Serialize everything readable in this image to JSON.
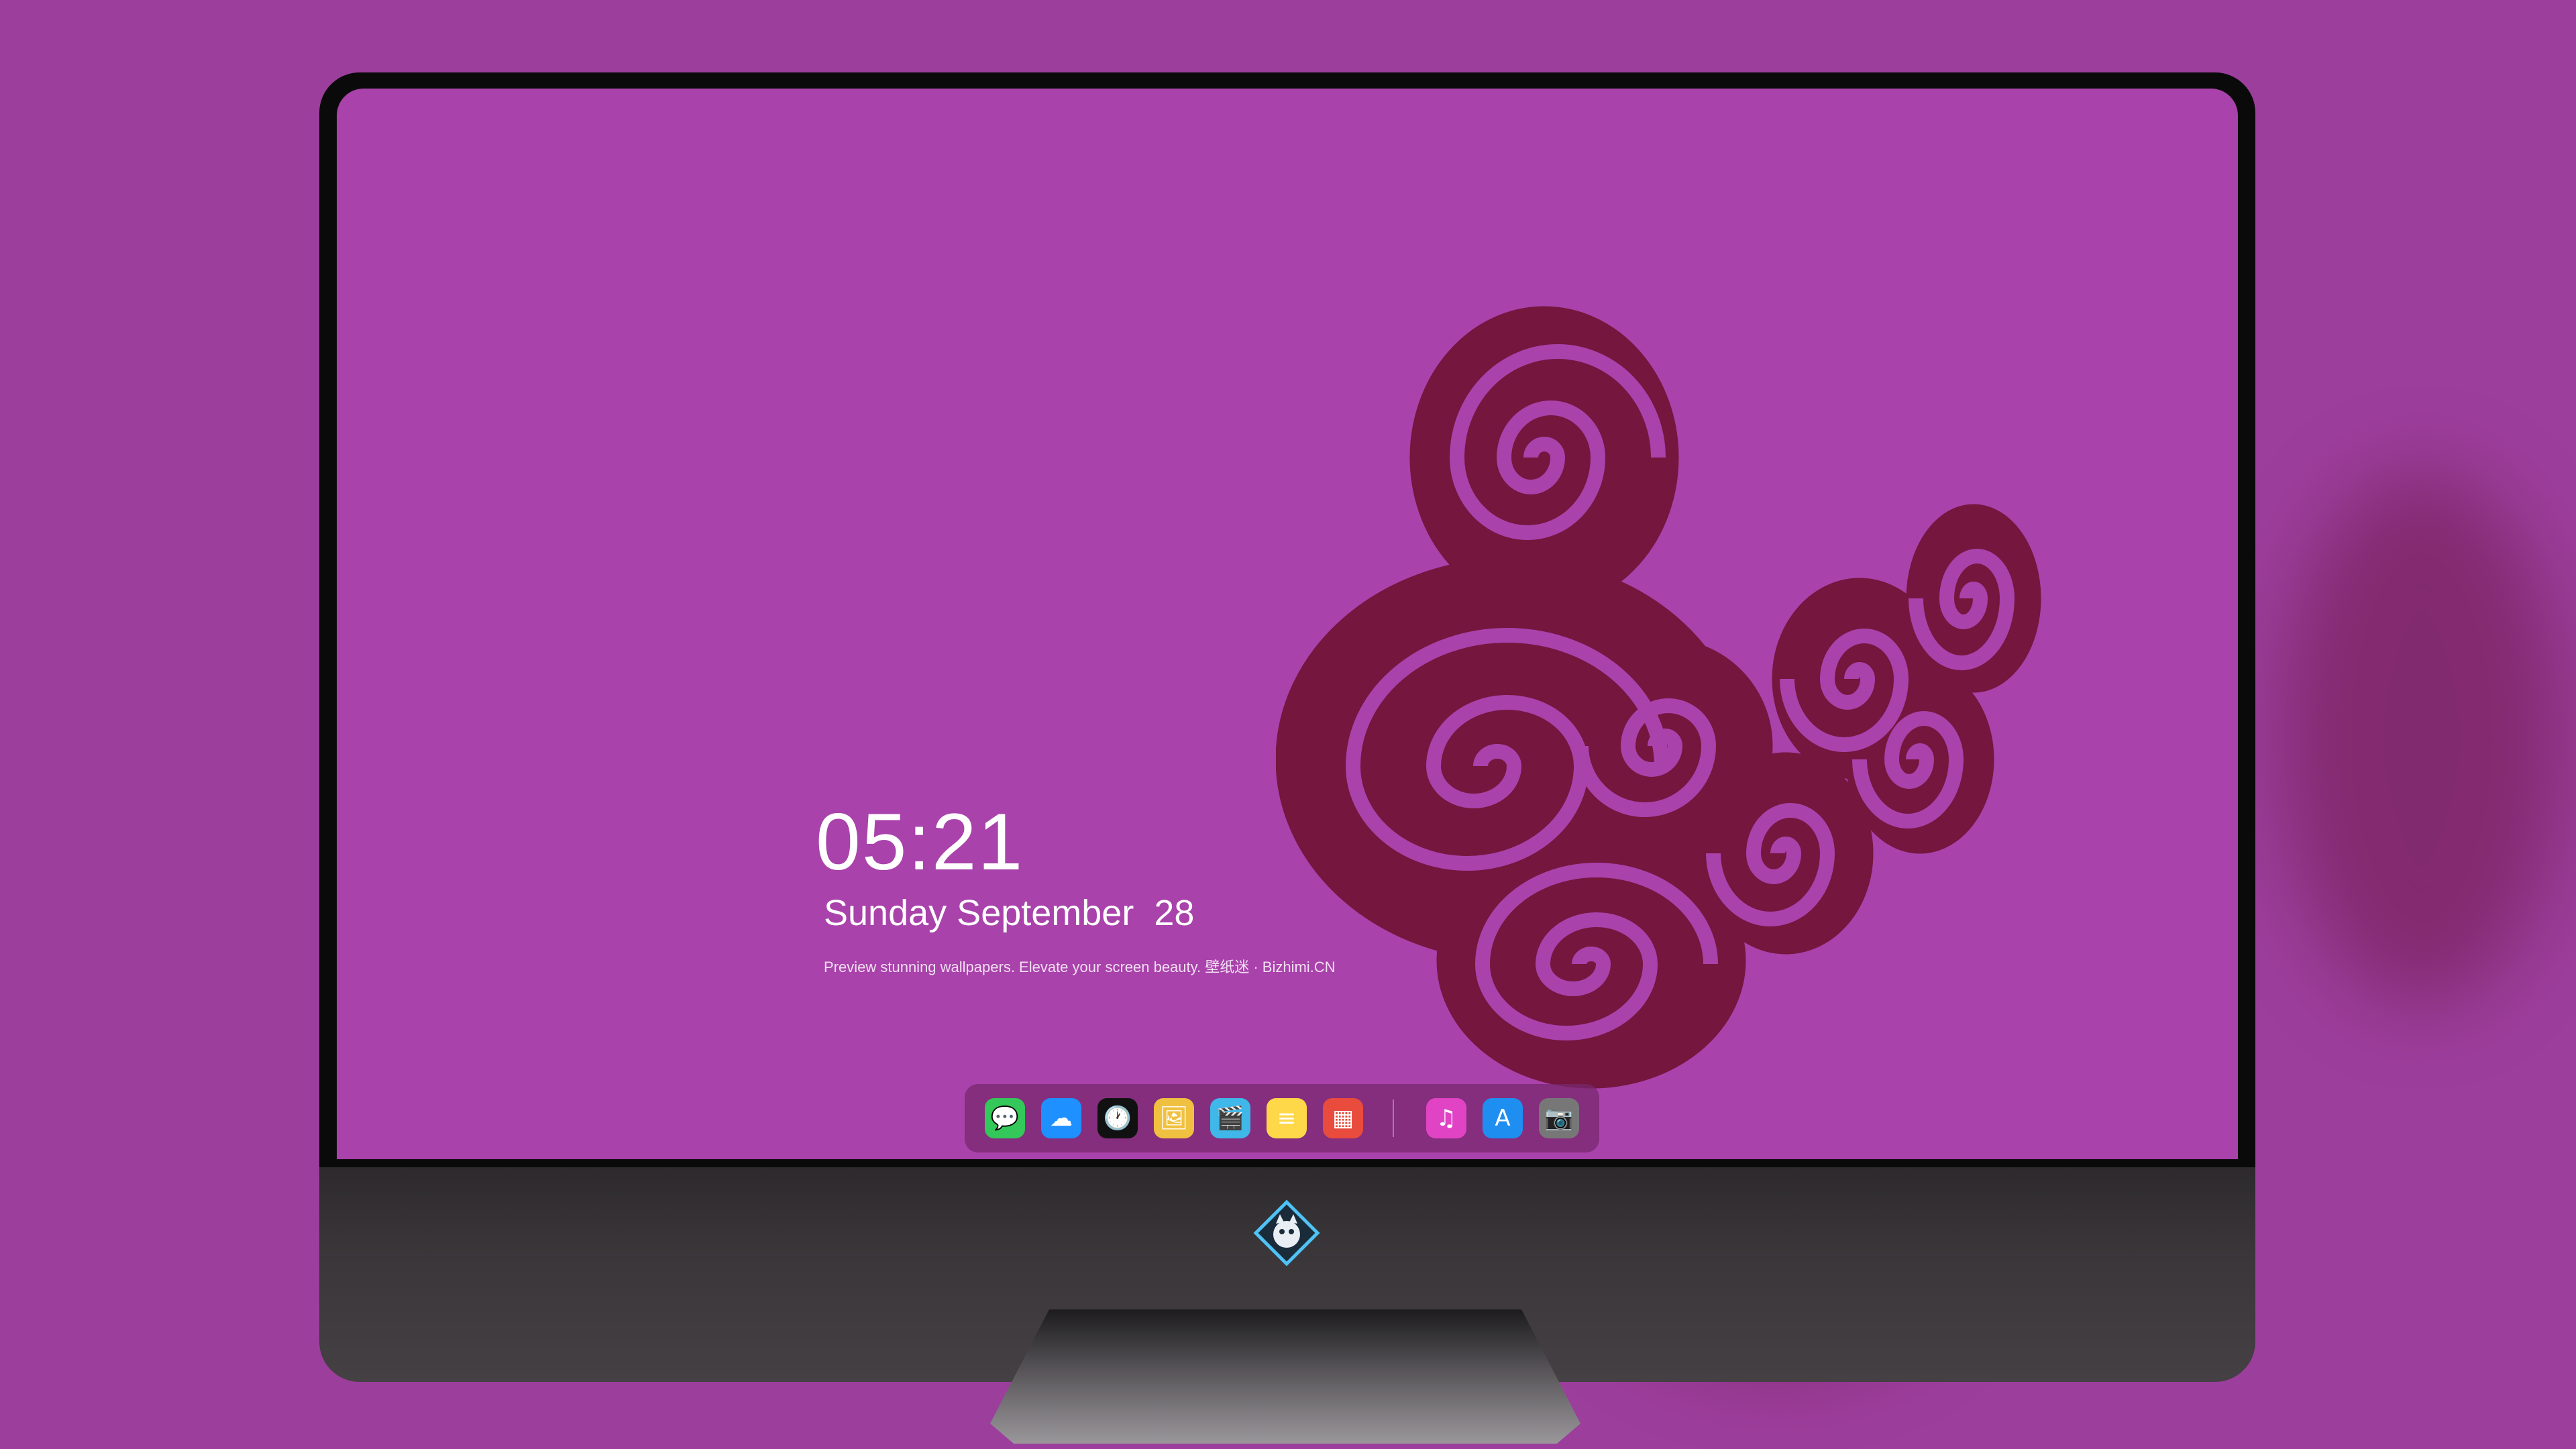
{
  "clock": {
    "time": "05:21"
  },
  "date": {
    "weekday": "Sunday",
    "month": "September",
    "day": "28"
  },
  "tagline": "Preview stunning wallpapers. Elevate your screen beauty. 壁纸迷 · Bizhimi.CN",
  "colors": {
    "background": "#9c3e9c",
    "screen": "#a942ab",
    "spiral": "#74163e",
    "spiral_light": "#a942ab"
  },
  "dock": {
    "apps": [
      {
        "name": "messages-icon",
        "color": "#34c759",
        "glyph": "💬"
      },
      {
        "name": "weather-icon",
        "color": "#1e90ff",
        "glyph": "☁"
      },
      {
        "name": "clock-icon",
        "color": "#111111",
        "glyph": "🕐"
      },
      {
        "name": "preview-icon",
        "color": "#f0c040",
        "glyph": "🖼"
      },
      {
        "name": "clips-icon",
        "color": "#3fb7e8",
        "glyph": "🎬"
      },
      {
        "name": "notes-icon",
        "color": "#ffd84a",
        "glyph": "≡"
      },
      {
        "name": "photo-booth-icon",
        "color": "#e94b3c",
        "glyph": "▦"
      }
    ],
    "apps_right": [
      {
        "name": "itunes-icon",
        "color": "#e043c4",
        "glyph": "♫"
      },
      {
        "name": "app-store-icon",
        "color": "#1f8ef1",
        "glyph": "A"
      },
      {
        "name": "camera-icon",
        "color": "#777777",
        "glyph": "📷"
      }
    ]
  }
}
